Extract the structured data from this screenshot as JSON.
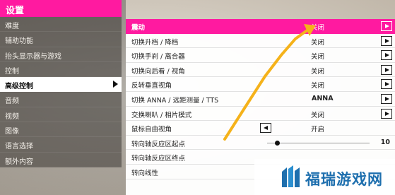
{
  "header": {
    "title": "设置"
  },
  "categories": [
    "难度",
    "辅助功能",
    "抬头显示器与游戏",
    "控制",
    "高级控制",
    "音频",
    "视频",
    "图像",
    "语言选择",
    "额外内容"
  ],
  "active_category_index": 4,
  "options": [
    {
      "label": "震动",
      "value": "关闭"
    },
    {
      "label": "切换升档 / 降档",
      "value": "关闭"
    },
    {
      "label": "切换手刹 / 离合器",
      "value": "关闭"
    },
    {
      "label": "切换向后看 / 视角",
      "value": "关闭"
    },
    {
      "label": "反转垂直视角",
      "value": "关闭"
    },
    {
      "label": "切换 ANNA / 远距测量 / TTS",
      "value": "ANNA"
    },
    {
      "label": "交换喇叭 / 相片模式",
      "value": "关闭"
    },
    {
      "label": "鼠标自由视角",
      "value": "开启"
    },
    {
      "label": "转向轴反应区起点",
      "value": "10"
    },
    {
      "label": "转向轴反应区终点",
      "value": ""
    },
    {
      "label": "转向线性",
      "value": ""
    }
  ],
  "slider_level": 0.1,
  "colors": {
    "accent": "#ff1aa0",
    "arrow": "#f5b21a",
    "watermark": "#1e6fae"
  },
  "watermark": {
    "text": "福瑞游戏网"
  }
}
